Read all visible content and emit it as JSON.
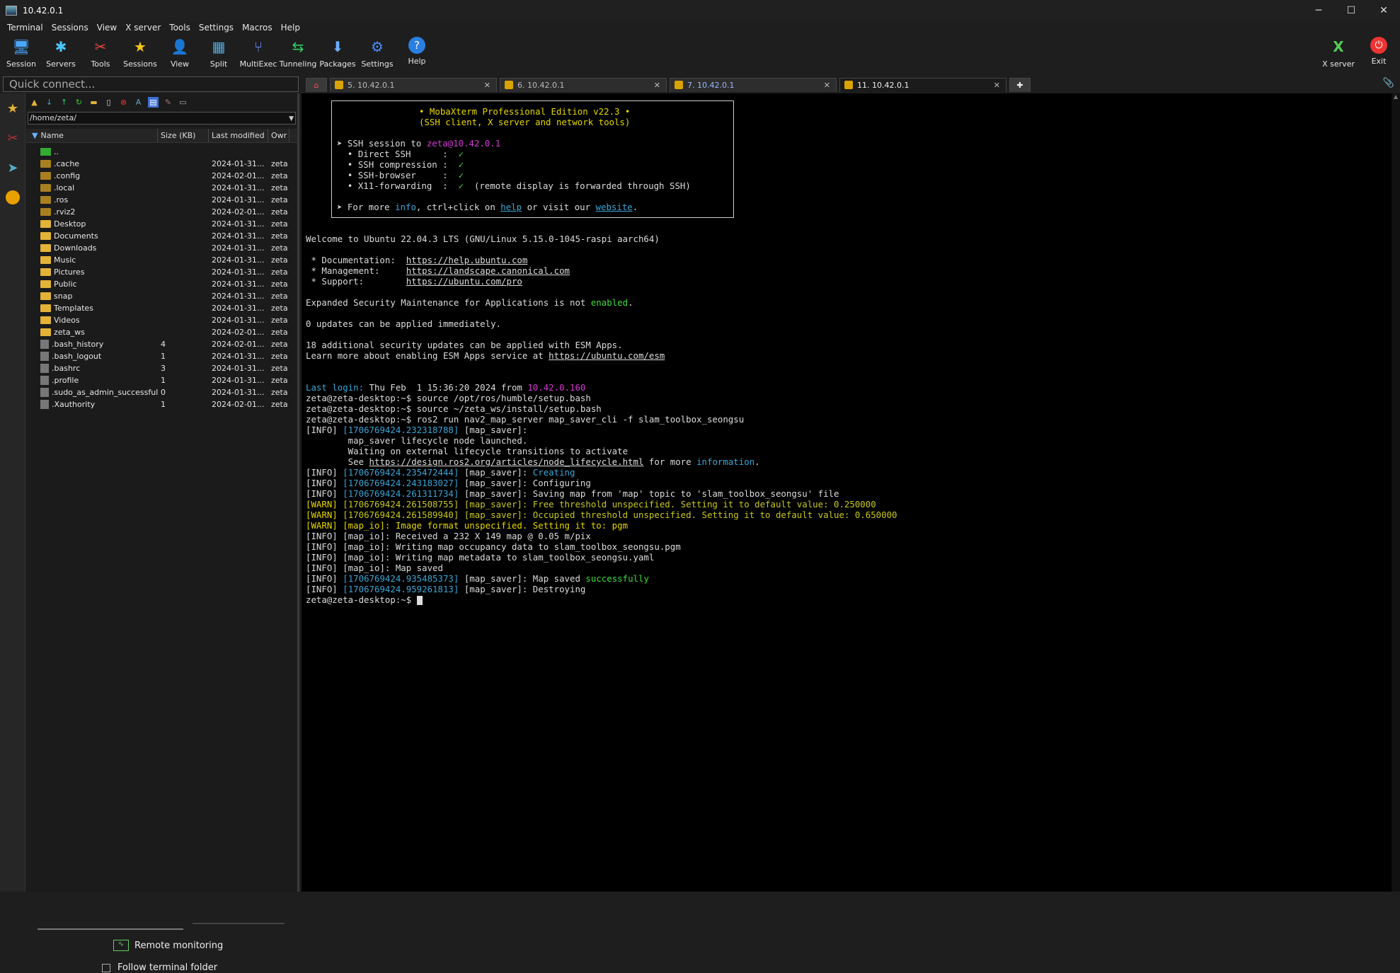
{
  "window": {
    "title": "10.42.0.1"
  },
  "menu": [
    "Terminal",
    "Sessions",
    "View",
    "X server",
    "Tools",
    "Settings",
    "Macros",
    "Help"
  ],
  "toolbar": {
    "session": "Session",
    "servers": "Servers",
    "tools": "Tools",
    "sessions": "Sessions",
    "view": "View",
    "split": "Split",
    "multiexec": "MultiExec",
    "tunneling": "Tunneling",
    "packages": "Packages",
    "settings": "Settings",
    "help": "Help",
    "xserver": "X server",
    "exit": "Exit"
  },
  "quick_connect": {
    "placeholder": "Quick connect..."
  },
  "tabs": [
    {
      "label": "5. 10.42.0.1"
    },
    {
      "label": "6. 10.42.0.1"
    },
    {
      "label": "7. 10.42.0.1"
    },
    {
      "label": "11. 10.42.0.1"
    }
  ],
  "sftp": {
    "path": "/home/zeta/",
    "columns": {
      "name": "Name",
      "size": "Size (KB)",
      "modified": "Last modified",
      "owner": "Owr"
    },
    "rows": [
      {
        "name": "..",
        "size": "",
        "modified": "",
        "owner": "",
        "type": "up"
      },
      {
        "name": ".cache",
        "size": "",
        "modified": "2024-01-31...",
        "owner": "zeta",
        "type": "dir-hidden"
      },
      {
        "name": ".config",
        "size": "",
        "modified": "2024-02-01...",
        "owner": "zeta",
        "type": "dir-hidden"
      },
      {
        "name": ".local",
        "size": "",
        "modified": "2024-01-31...",
        "owner": "zeta",
        "type": "dir-hidden"
      },
      {
        "name": ".ros",
        "size": "",
        "modified": "2024-01-31...",
        "owner": "zeta",
        "type": "dir-hidden"
      },
      {
        "name": ".rviz2",
        "size": "",
        "modified": "2024-02-01...",
        "owner": "zeta",
        "type": "dir-hidden"
      },
      {
        "name": "Desktop",
        "size": "",
        "modified": "2024-01-31...",
        "owner": "zeta",
        "type": "dir"
      },
      {
        "name": "Documents",
        "size": "",
        "modified": "2024-01-31...",
        "owner": "zeta",
        "type": "dir"
      },
      {
        "name": "Downloads",
        "size": "",
        "modified": "2024-01-31...",
        "owner": "zeta",
        "type": "dir"
      },
      {
        "name": "Music",
        "size": "",
        "modified": "2024-01-31...",
        "owner": "zeta",
        "type": "dir"
      },
      {
        "name": "Pictures",
        "size": "",
        "modified": "2024-01-31...",
        "owner": "zeta",
        "type": "dir"
      },
      {
        "name": "Public",
        "size": "",
        "modified": "2024-01-31...",
        "owner": "zeta",
        "type": "dir"
      },
      {
        "name": "snap",
        "size": "",
        "modified": "2024-01-31...",
        "owner": "zeta",
        "type": "dir"
      },
      {
        "name": "Templates",
        "size": "",
        "modified": "2024-01-31...",
        "owner": "zeta",
        "type": "dir"
      },
      {
        "name": "Videos",
        "size": "",
        "modified": "2024-01-31...",
        "owner": "zeta",
        "type": "dir"
      },
      {
        "name": "zeta_ws",
        "size": "",
        "modified": "2024-02-01...",
        "owner": "zeta",
        "type": "dir"
      },
      {
        "name": ".bash_history",
        "size": "4",
        "modified": "2024-02-01...",
        "owner": "zeta",
        "type": "file"
      },
      {
        "name": ".bash_logout",
        "size": "1",
        "modified": "2024-01-31...",
        "owner": "zeta",
        "type": "file"
      },
      {
        "name": ".bashrc",
        "size": "3",
        "modified": "2024-01-31...",
        "owner": "zeta",
        "type": "file"
      },
      {
        "name": ".profile",
        "size": "1",
        "modified": "2024-01-31...",
        "owner": "zeta",
        "type": "file"
      },
      {
        "name": ".sudo_as_admin_successful",
        "size": "0",
        "modified": "2024-01-31...",
        "owner": "zeta",
        "type": "file"
      },
      {
        "name": ".Xauthority",
        "size": "1",
        "modified": "2024-02-01...",
        "owner": "zeta",
        "type": "file"
      }
    ],
    "remote_monitoring": "Remote monitoring",
    "follow_terminal": "Follow terminal folder"
  },
  "terminal": {
    "banner_title": "• MobaXterm Professional Edition v22.3 •",
    "banner_sub": "(SSH client, X server and network tools)",
    "ssh_session_prefix": "➤ SSH session to ",
    "ssh_target": "zeta@10.42.0.1",
    "features": [
      {
        "label": "  • Direct SSH      :  ",
        "mark": "✓",
        "note": ""
      },
      {
        "label": "  • SSH compression :  ",
        "mark": "✓",
        "note": ""
      },
      {
        "label": "  • SSH-browser     :  ",
        "mark": "✓",
        "note": ""
      },
      {
        "label": "  • X11-forwarding  :  ",
        "mark": "✓",
        "note": "  (remote display is forwarded through SSH)"
      }
    ],
    "more_prefix": "➤ For more ",
    "more_info": "info",
    "more_mid": ", ctrl+click on ",
    "more_help": "help",
    "more_mid2": " or visit our ",
    "more_website": "website",
    "more_end": ".",
    "welcome": "Welcome to Ubuntu 22.04.3 LTS (GNU/Linux 5.15.0-1045-raspi aarch64)",
    "doc_label": " * Documentation:  ",
    "doc_url": "https://help.ubuntu.com",
    "mgmt_label": " * Management:     ",
    "mgmt_url": "https://landscape.canonical.com",
    "support_label": " * Support:        ",
    "support_url": "https://ubuntu.com/pro",
    "esm_prefix": "Expanded Security Maintenance for Applications is not ",
    "esm_enabled": "enabled",
    "esm_end": ".",
    "updates": "0 updates can be applied immediately.",
    "sec_updates": "18 additional security updates can be applied with ESM Apps.",
    "learn_prefix": "Learn more about enabling ESM Apps service at ",
    "learn_url": "https://ubuntu.com/esm",
    "last_login_prefix": "Last login: ",
    "last_login_time": "Thu Feb  1 15:36:20 2024 from ",
    "last_login_ip": "10.42.0.160",
    "cmd1": "zeta@zeta-desktop:~$ source /opt/ros/humble/setup.bash",
    "cmd2": "zeta@zeta-desktop:~$ source ~/zeta_ws/install/setup.bash",
    "cmd3": "zeta@zeta-desktop:~$ ros2 run nav2_map_server map_saver_cli -f slam_toolbox_seongsu",
    "log": [
      {
        "level": "[INFO]",
        "ts": "[1706769424.232318788]",
        "src": " [map_saver]:",
        "msg": "",
        "msgcolor": ""
      },
      {
        "level": "",
        "ts": "",
        "src": "        map_saver lifecycle node launched.",
        "msg": "",
        "msgcolor": ""
      },
      {
        "level": "",
        "ts": "",
        "src": "        Waiting on external lifecycle transitions to activate",
        "msg": "",
        "msgcolor": ""
      },
      {
        "level": "",
        "ts": "",
        "src": "",
        "msg": "",
        "msgcolor": ""
      },
      {
        "level": "[INFO]",
        "ts": "[1706769424.235472444]",
        "src": " [map_saver]: ",
        "msg": "Creating",
        "msgcolor": "c"
      },
      {
        "level": "[INFO]",
        "ts": "[1706769424.243183027]",
        "src": " [map_saver]: Configuring",
        "msg": "",
        "msgcolor": ""
      },
      {
        "level": "[INFO]",
        "ts": "[1706769424.261311734]",
        "src": " [map_saver]: Saving map from 'map' topic to 'slam_toolbox_seongsu' file",
        "msg": "",
        "msgcolor": ""
      },
      {
        "level": "[WARN]",
        "ts": "[1706769424.261508755]",
        "src": "",
        "msg": " [map_saver]: Free threshold unspecified. Setting it to default value: 0.250000",
        "msgcolor": "w"
      },
      {
        "level": "[WARN]",
        "ts": "[1706769424.261589940]",
        "src": "",
        "msg": " [map_saver]: Occupied threshold unspecified. Setting it to default value: 0.650000",
        "msgcolor": "w"
      },
      {
        "level": "[WARN]",
        "ts": "",
        "src": " [map_io]: Image format unspecified. Setting it to: pgm",
        "msg": "",
        "msgcolor": "w"
      },
      {
        "level": "[INFO]",
        "ts": "",
        "src": " [map_io]: Received a 232 X 149 map @ 0.05 m/pix",
        "msg": "",
        "msgcolor": ""
      },
      {
        "level": "[INFO]",
        "ts": "",
        "src": " [map_io]: Writing map occupancy data to slam_toolbox_seongsu.pgm",
        "msg": "",
        "msgcolor": ""
      },
      {
        "level": "[INFO]",
        "ts": "",
        "src": " [map_io]: Writing map metadata to slam_toolbox_seongsu.yaml",
        "msg": "",
        "msgcolor": ""
      },
      {
        "level": "[INFO]",
        "ts": "",
        "src": " [map_io]: Map saved",
        "msg": "",
        "msgcolor": ""
      },
      {
        "level": "[INFO]",
        "ts": "[1706769424.935485373]",
        "src": " [map_saver]: Map saved ",
        "msg": "successfully",
        "msgcolor": "g"
      },
      {
        "level": "[INFO]",
        "ts": "[1706769424.959261813]",
        "src": " [map_saver]: Destroying",
        "msg": "",
        "msgcolor": ""
      }
    ],
    "see_prefix": "        See ",
    "see_url": "https://design.ros2.org/articles/node_lifecycle.html",
    "see_mid": " for more ",
    "see_info": "information",
    "see_end": ".",
    "prompt": "zeta@zeta-desktop:~$ "
  }
}
